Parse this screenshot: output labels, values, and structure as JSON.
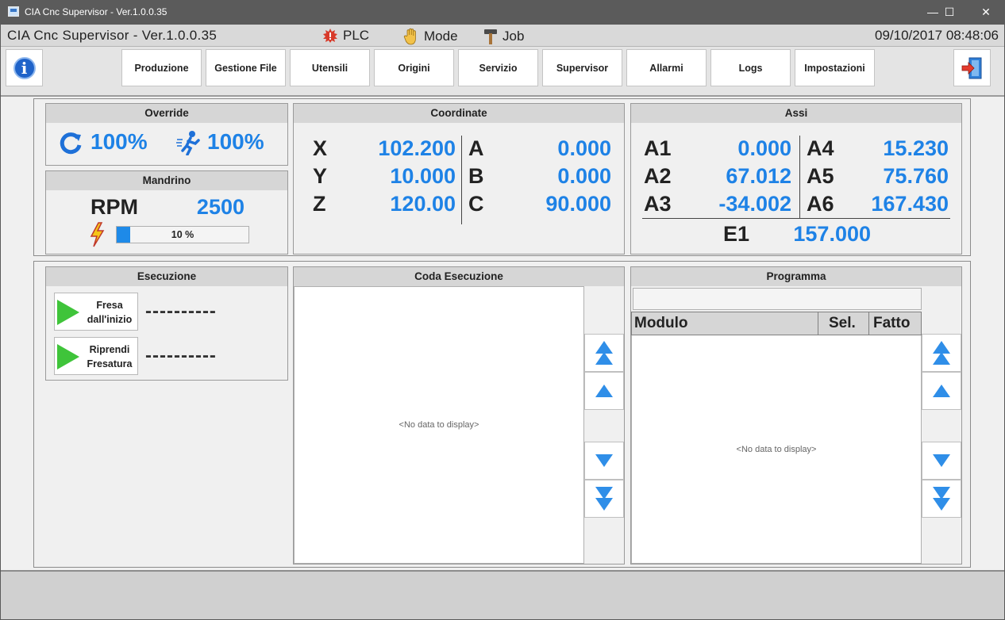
{
  "window": {
    "title": "CIA Cnc Supervisor - Ver.1.0.0.35",
    "minimize": "—",
    "maximize": "☐",
    "close": "✕"
  },
  "statusbar": {
    "app_title": "CIA Cnc Supervisor - Ver.1.0.0.35",
    "plc_label": "PLC",
    "mode_label": "Mode",
    "job_label": "Job",
    "datetime": "09/10/2017 08:48:06"
  },
  "toolbar": {
    "buttons": [
      "Produzione",
      "Gestione File",
      "Utensili",
      "Origini",
      "Servizio",
      "Supervisor",
      "Allarmi",
      "Logs",
      "Impostazioni"
    ]
  },
  "override": {
    "title": "Override",
    "feed": "100%",
    "rapid": "100%"
  },
  "mandrino": {
    "title": "Mandrino",
    "rpm_label": "RPM",
    "rpm_value": "2500",
    "load_text": "10 %",
    "load_percent": 10
  },
  "coordinate": {
    "title": "Coordinate",
    "left": [
      {
        "axis": "X",
        "value": "102.200"
      },
      {
        "axis": "Y",
        "value": "10.000"
      },
      {
        "axis": "Z",
        "value": "120.00"
      }
    ],
    "right": [
      {
        "axis": "A",
        "value": "0.000"
      },
      {
        "axis": "B",
        "value": "0.000"
      },
      {
        "axis": "C",
        "value": "90.000"
      }
    ]
  },
  "assi": {
    "title": "Assi",
    "left": [
      {
        "axis": "A1",
        "value": "0.000"
      },
      {
        "axis": "A2",
        "value": "67.012"
      },
      {
        "axis": "A3",
        "value": "-34.002"
      }
    ],
    "right": [
      {
        "axis": "A4",
        "value": "15.230"
      },
      {
        "axis": "A5",
        "value": "75.760"
      },
      {
        "axis": "A6",
        "value": "167.430"
      }
    ],
    "e1_label": "E1",
    "e1_value": "157.000"
  },
  "esecuzione": {
    "title": "Esecuzione",
    "btn1_line1": "Fresa",
    "btn1_line2": "dall'inizio",
    "btn2_line1": "Riprendi",
    "btn2_line2": "Fresatura",
    "status1": "----------",
    "status2": "----------"
  },
  "coda": {
    "title": "Coda Esecuzione",
    "empty": "<No data to display>"
  },
  "programma": {
    "title": "Programma",
    "col_modulo": "Modulo",
    "col_sel": "Sel.",
    "col_fatto": "Fatto",
    "empty": "<No data to display>"
  }
}
